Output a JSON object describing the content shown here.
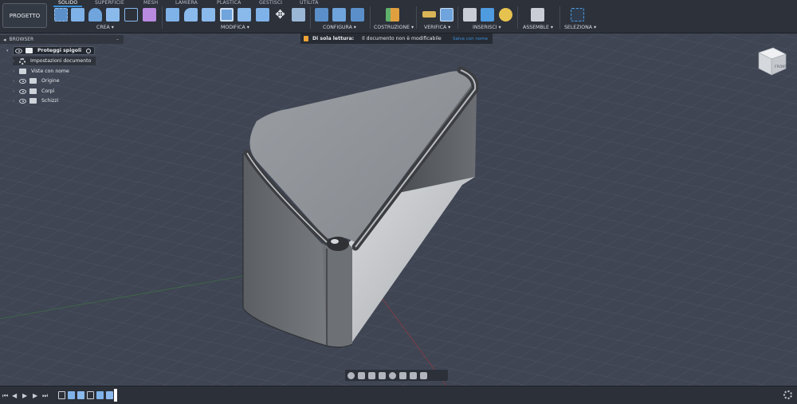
{
  "toolbar": {
    "project_label": "PROGETTO",
    "tabs": [
      {
        "label": "SOLIDO",
        "active": true
      },
      {
        "label": "SUPERFICIE",
        "active": false
      },
      {
        "label": "MESH",
        "active": false
      },
      {
        "label": "LAMIERA",
        "active": false
      },
      {
        "label": "PLASTICA",
        "active": false
      },
      {
        "label": "GESTISCI",
        "active": false
      },
      {
        "label": "UTILITÀ",
        "active": false
      }
    ],
    "groups": [
      {
        "label": "CREA ▾"
      },
      {
        "label": "MODIFICA ▾"
      },
      {
        "label": "CONFIGURA ▾"
      },
      {
        "label": "COSTRUZIONE ▾"
      },
      {
        "label": "VERIFICA ▾"
      },
      {
        "label": "INSERISCI ▾"
      },
      {
        "label": "ASSEMBLE ▾"
      },
      {
        "label": "SELEZIONA ▾"
      }
    ],
    "tool_icons": [
      "create-sketch-icon",
      "extrude-icon",
      "revolve-icon",
      "hole-icon",
      "sketch-dimension-icon",
      "new-component-icon",
      "press-pull-icon",
      "fillet-icon",
      "chamfer-icon",
      "shell-icon",
      "draft-icon",
      "split-icon",
      "move-icon",
      "align-icon",
      "parameters-icon",
      "table-icon",
      "configure-icon",
      "offset-plane-icon",
      "measure-icon",
      "section-analysis-icon",
      "insert-decal-icon",
      "insert-canvas-icon",
      "insert-mesh-icon",
      "joint-icon",
      "select-icon"
    ]
  },
  "browser": {
    "title": "BROWSER",
    "root": "Proteggi spigoli",
    "items": [
      {
        "label": "Impostazioni documento",
        "icon": "gear-icon"
      },
      {
        "label": "Viste con nome",
        "icon": "folder-icon"
      },
      {
        "label": "Origine",
        "icon": "folder-icon"
      },
      {
        "label": "Corpi",
        "icon": "folder-icon"
      },
      {
        "label": "Schizzi",
        "icon": "folder-icon"
      }
    ]
  },
  "banner": {
    "title": "Di sola lettura:",
    "message": "Il documento non è modificabile",
    "action": "Salva con nome"
  },
  "viewcube": {
    "label": "FRONT"
  },
  "colors": {
    "accent": "#3a8fd8",
    "lock": "#f0a436",
    "viewport_bg": "#3f4553",
    "toolbar_bg": "#2c313a"
  }
}
